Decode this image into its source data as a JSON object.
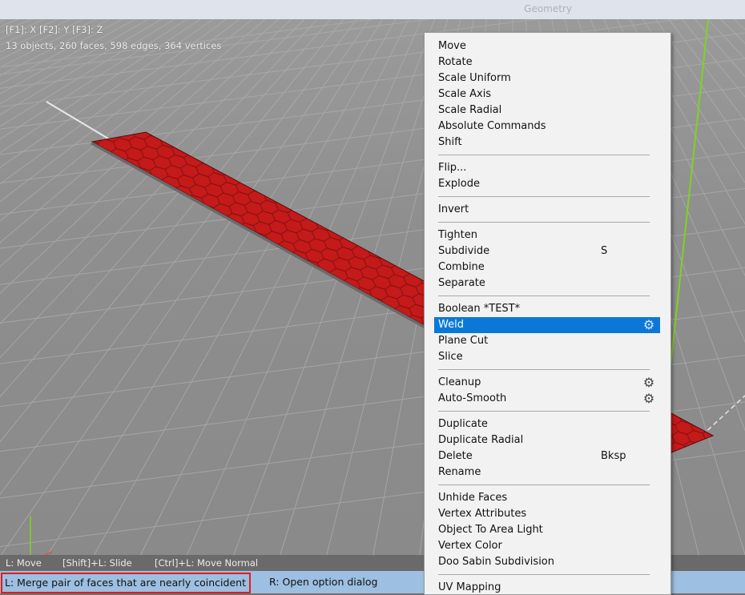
{
  "title": "Geometry",
  "hud": {
    "keys": "[F1]: X    [F2]: Y    [F3]: Z",
    "stats": "13 objects, 260 faces, 598 edges, 364 vertices"
  },
  "hints": {
    "move": "L: Move",
    "slide": "[Shift]+L: Slide",
    "move_normal": "[Ctrl]+L: Move Normal"
  },
  "status": {
    "left": "L: Merge pair of faces that are nearly coincident",
    "right": "R: Open option dialog"
  },
  "menu": {
    "items": [
      {
        "label": "Move"
      },
      {
        "label": "Rotate"
      },
      {
        "label": "Scale Uniform"
      },
      {
        "label": "Scale Axis"
      },
      {
        "label": "Scale Radial"
      },
      {
        "label": "Absolute Commands"
      },
      {
        "label": "Shift"
      },
      {
        "label": "Flip..."
      },
      {
        "label": "Explode"
      },
      {
        "label": "Invert"
      },
      {
        "label": "Tighten"
      },
      {
        "label": "Subdivide",
        "shortcut": "S"
      },
      {
        "label": "Combine"
      },
      {
        "label": "Separate"
      },
      {
        "label": "Boolean *TEST*"
      },
      {
        "label": "Weld",
        "selected": true,
        "icon": "gear-icon"
      },
      {
        "label": "Plane Cut"
      },
      {
        "label": "Slice"
      },
      {
        "label": "Cleanup",
        "icon": "gear-icon"
      },
      {
        "label": "Auto-Smooth",
        "icon": "gear-icon"
      },
      {
        "label": "Duplicate"
      },
      {
        "label": "Duplicate Radial"
      },
      {
        "label": "Delete",
        "shortcut": "Bksp"
      },
      {
        "label": "Rename"
      },
      {
        "label": "Unhide Faces"
      },
      {
        "label": "Vertex Attributes"
      },
      {
        "label": "Object To Area Light"
      },
      {
        "label": "Vertex Color"
      },
      {
        "label": "Doo Sabin Subdivision"
      },
      {
        "label": "UV Mapping"
      }
    ]
  },
  "colors": {
    "accent_selected": "#0b78d7",
    "status_highlight": "#e21b1b",
    "mesh": "#c41a1a",
    "y_axis": "#7ed321"
  }
}
